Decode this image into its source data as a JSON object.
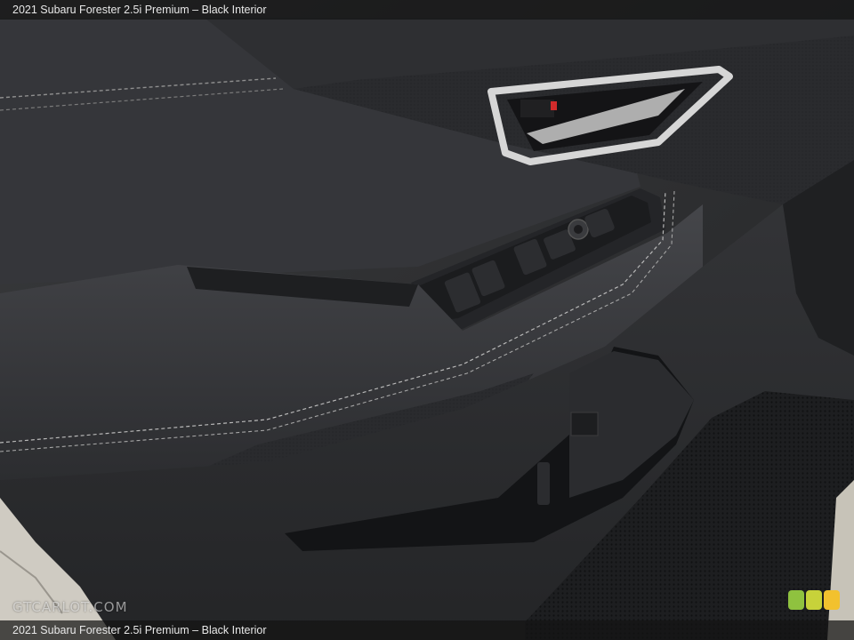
{
  "caption": {
    "top": "2021 Subaru Forester 2.5i Premium – Black Interior",
    "bottom": "2021 Subaru Forester 2.5i Premium – Black Interior"
  },
  "watermark": {
    "text": "GTCARLOT.COM"
  },
  "colors": {
    "panel": "#2f3032",
    "trim_light": "#4a4b4d",
    "stitching": "#bdbdbd",
    "chrome": "#d9d9d9",
    "badge_green": "#8fc23f",
    "badge_yellow": "#f2c12e"
  }
}
